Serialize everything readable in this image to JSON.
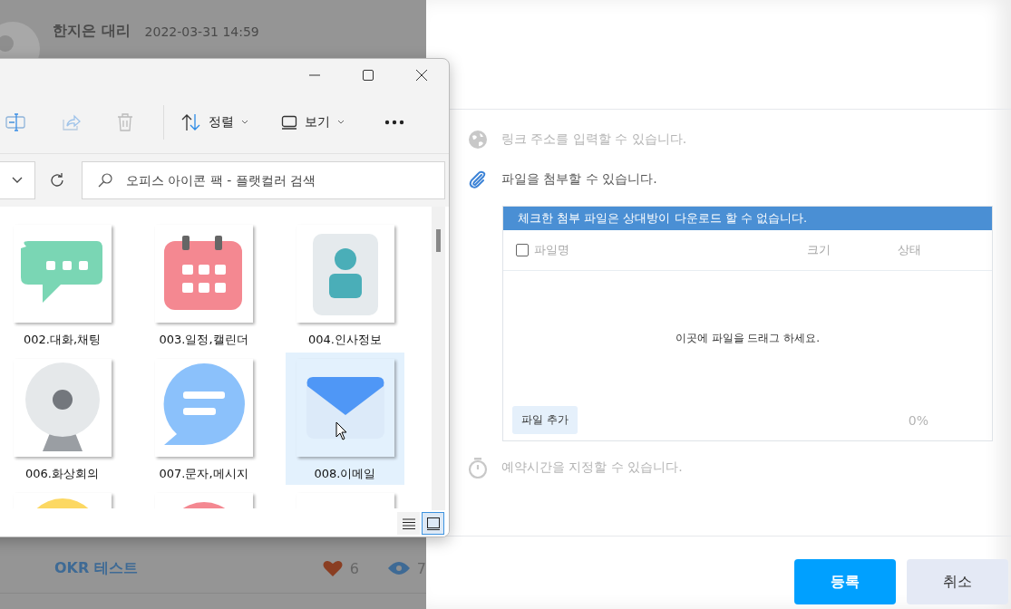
{
  "feed": {
    "author": "한지은 대리",
    "date": "2022-03-31 14:59",
    "next_post": {
      "title": "OKR 테스트",
      "likes": "6",
      "views": "7"
    }
  },
  "explorer": {
    "toolbar": [
      {
        "kind": "rename"
      },
      {
        "kind": "share"
      },
      {
        "kind": "delete"
      },
      {
        "kind": "sort",
        "label": "정렬"
      },
      {
        "kind": "view",
        "label": "보기"
      },
      {
        "kind": "more"
      }
    ],
    "search": {
      "placeholder": "오피스 아이콘 팩 - 플랫컬러 검색"
    },
    "files": [
      {
        "name": "002.대화,채팅",
        "kind": "chat",
        "selected": false
      },
      {
        "name": "003.일정,캘린더",
        "kind": "calendar",
        "selected": false
      },
      {
        "name": "004.인사정보",
        "kind": "person",
        "selected": false
      },
      {
        "name": "006.화상회의",
        "kind": "webcam",
        "selected": false
      },
      {
        "name": "007.문자,메시지",
        "kind": "message",
        "selected": false
      },
      {
        "name": "008.이메일",
        "kind": "mail",
        "selected": true
      },
      {
        "kind": "round-yellow",
        "selected": false
      },
      {
        "kind": "round-pink",
        "selected": false
      },
      {
        "kind": "blank",
        "selected": false
      }
    ],
    "view_modes": [
      {
        "kind": "details",
        "selected": false
      },
      {
        "kind": "tiles",
        "selected": true
      }
    ]
  },
  "composer": {
    "options": [
      {
        "kind": "link",
        "label": "링크 주소를 입력할 수 있습니다.",
        "active": false
      },
      {
        "kind": "attach",
        "label": "파일을 첨부할 수 있습니다.",
        "active": true
      },
      {
        "kind": "schedule",
        "label": "예약시간을 지정할 수 있습니다.",
        "active": false
      }
    ],
    "attachments": {
      "notice": "체크한 첨부 파일은 상대방이 다운로드 할 수 없습니다.",
      "select_all_checked": false,
      "columns": [
        "파일명",
        "크기",
        "상태"
      ],
      "drop_hint": "이곳에 파일을 드래그 하세요.",
      "add_button": "파일 추가",
      "progress": "0%"
    },
    "buttons": [
      {
        "kind": "primary",
        "label": "등록"
      },
      {
        "kind": "secondary",
        "label": "취소"
      }
    ]
  }
}
